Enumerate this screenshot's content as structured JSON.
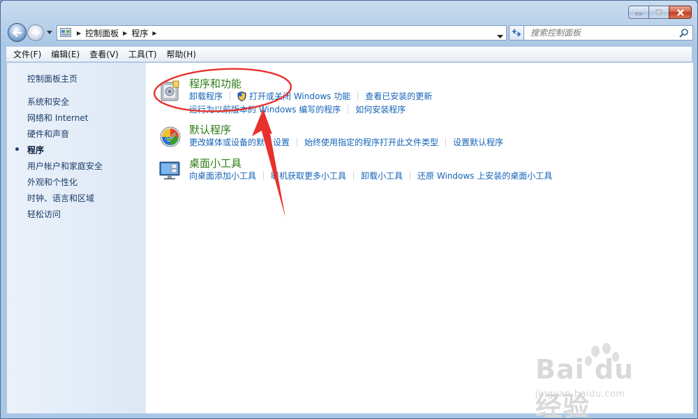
{
  "window": {
    "minimize_icon": "minimize-icon",
    "maximize_icon": "maximize-icon",
    "close_icon": "close-icon"
  },
  "navigation": {
    "back_icon": "back-arrow-icon",
    "forward_icon": "forward-arrow-icon",
    "breadcrumbs": [
      "控制面板",
      "程序"
    ],
    "search_placeholder": "搜索控制面板"
  },
  "menu": [
    "文件(F)",
    "编辑(E)",
    "查看(V)",
    "工具(T)",
    "帮助(H)"
  ],
  "sidebar": {
    "home": "控制面板主页",
    "items": [
      {
        "label": "系统和安全",
        "current": false
      },
      {
        "label": "网络和 Internet",
        "current": false
      },
      {
        "label": "硬件和声音",
        "current": false
      },
      {
        "label": "程序",
        "current": true
      },
      {
        "label": "用户帐户和家庭安全",
        "current": false
      },
      {
        "label": "外观和个性化",
        "current": false
      },
      {
        "label": "时钟、语言和区域",
        "current": false
      },
      {
        "label": "轻松访问",
        "current": false
      }
    ]
  },
  "categories": [
    {
      "title": "程序和功能",
      "icon": "programs-features-icon",
      "rows": [
        [
          "卸载程序",
          "打开或关闭 Windows 功能",
          "查看已安装的更新"
        ],
        [
          "运行为以前版本的 Windows 编写的程序",
          "如何安装程序"
        ]
      ]
    },
    {
      "title": "默认程序",
      "icon": "default-programs-icon",
      "rows": [
        [
          "更改媒体或设备的默认设置",
          "始终使用指定的程序打开此文件类型",
          "设置默认程序"
        ]
      ]
    },
    {
      "title": "桌面小工具",
      "icon": "desktop-gadgets-icon",
      "rows": [
        [
          "向桌面添加小工具",
          "联机获取更多小工具",
          "卸载小工具",
          "还原 Windows 上安装的桌面小工具"
        ]
      ]
    }
  ],
  "watermark": {
    "brand": "Bai du 经验",
    "url": "jingyan.baidu.com"
  },
  "colors": {
    "category_title": "#2e7d12",
    "task_link": "#1463b7",
    "annotation": "#e8312c"
  }
}
